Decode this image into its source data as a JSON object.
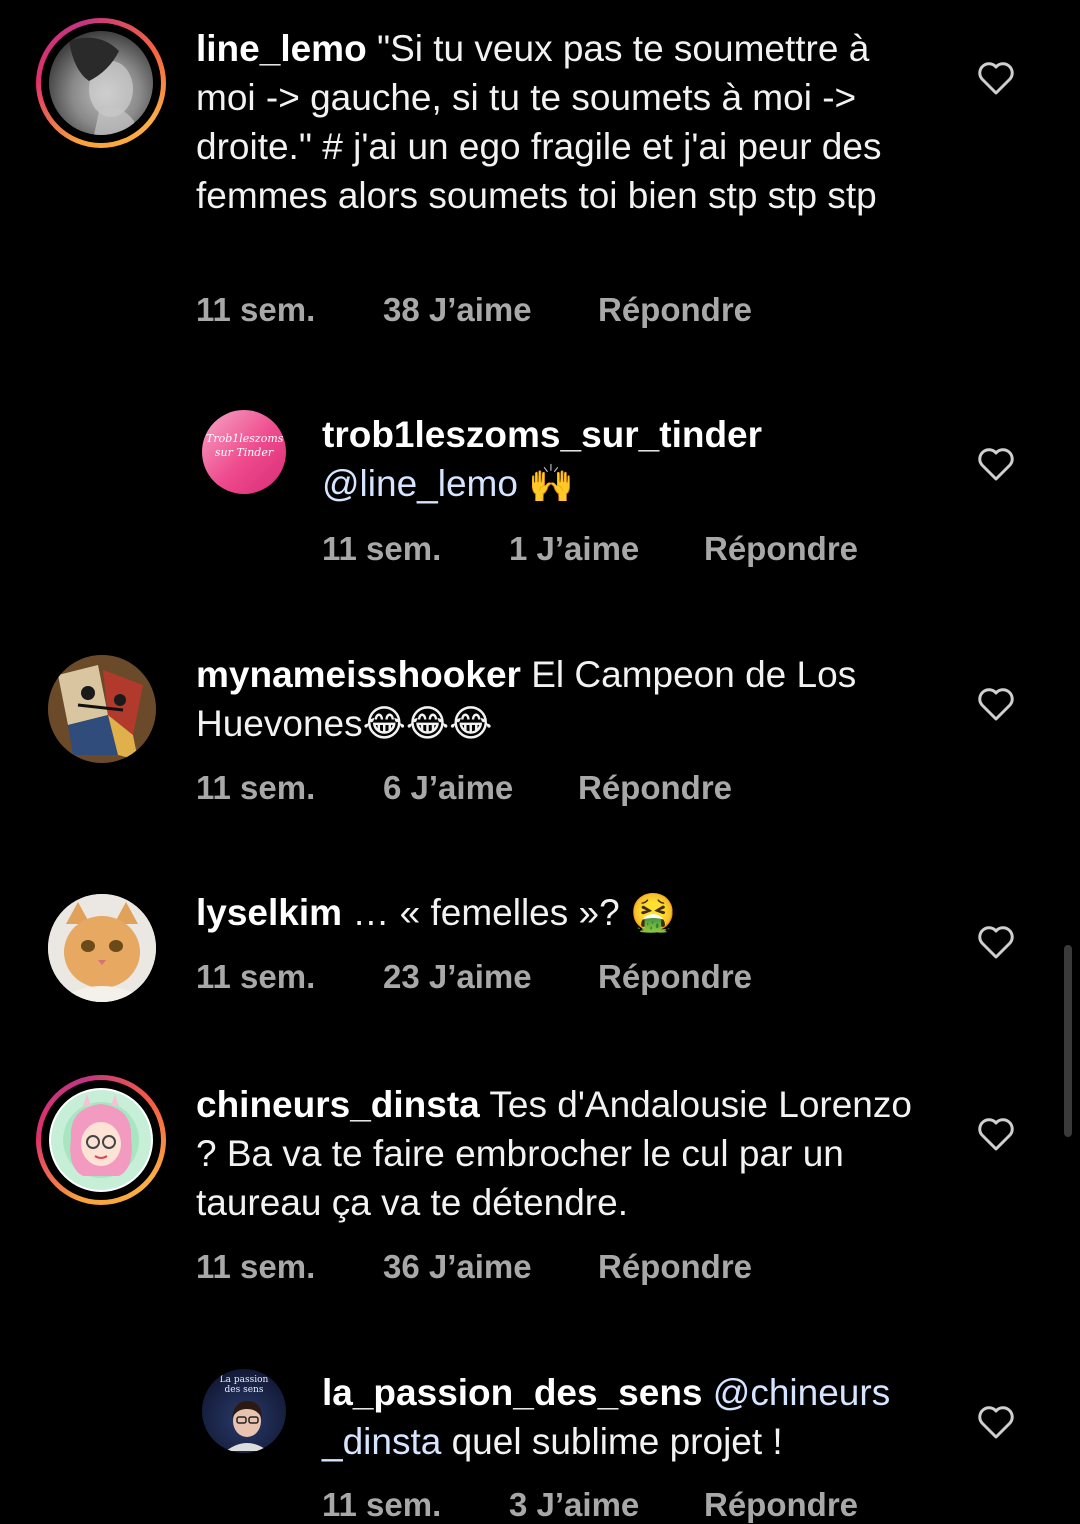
{
  "comments": [
    {
      "username": "line_lemo",
      "text": "\"Si tu veux pas te soumettre à moi -> gauche, si tu te soumets à moi -> droite.\" # j'ai un ego fragile et j'ai peur des femmes alors soumets toi bien stp stp stp",
      "time": "11 sem.",
      "likes": "38 J’aime",
      "reply": "Répondre",
      "avatar_icon": "profile-photo"
    },
    {
      "username": "trob1leszoms_sur_tinder",
      "mention": "@line_lemo",
      "text": "🙌",
      "time": "11 sem.",
      "likes": "1 J’aime",
      "reply": "Répondre",
      "avatar_text": "Trob1leszoms sur Tinder"
    },
    {
      "username": "mynameisshooker",
      "text": "El Campeon de Los Huevones😂😂😂",
      "time": "11 sem.",
      "likes": "6 J’aime",
      "reply": "Répondre",
      "avatar_icon": "abstract-painting"
    },
    {
      "username": "lyselkim",
      "text": "… « femelles »? 🤮",
      "time": "11 sem.",
      "likes": "23 J’aime",
      "reply": "Répondre",
      "avatar_icon": "cat-photo"
    },
    {
      "username": "chineurs_dinsta",
      "text": "Tes d'Andalousie Lorenzo ? Ba va te faire embrocher le cul par un taureau ça va te détendre.",
      "time": "11 sem.",
      "likes": "36 J’aime",
      "reply": "Répondre",
      "avatar_icon": "cartoon-girl"
    },
    {
      "username": "la_passion_des_sens",
      "mention": "@chineurs _dinsta",
      "text": "quel sublime projet !",
      "time": "11 sem.",
      "likes": "3 J’aime",
      "reply": "Répondre",
      "avatar_text": "La passion des sens"
    }
  ],
  "colors": {
    "background": "#000000",
    "text": "#f2f2f2",
    "meta": "#a8a8a8",
    "mention": "#d6e4ff",
    "story_ring": "#e1306c"
  }
}
